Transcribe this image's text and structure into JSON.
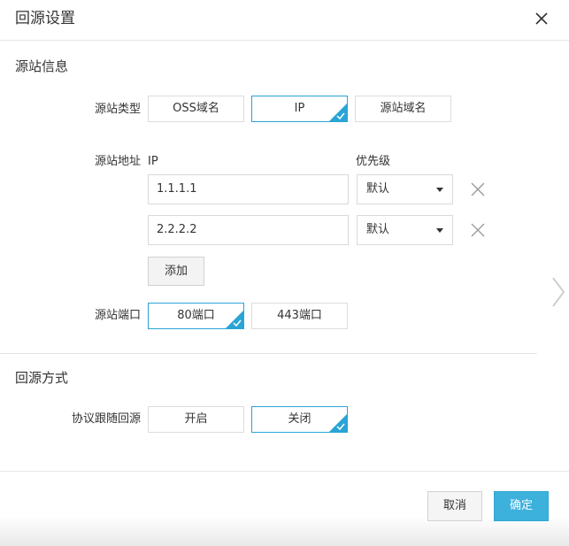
{
  "dialog": {
    "title": "回源设置",
    "close_icon": "close-icon"
  },
  "origin_info": {
    "section_title": "源站信息",
    "type": {
      "label": "源站类型",
      "options": [
        "OSS域名",
        "IP",
        "源站域名"
      ],
      "selected": "IP"
    },
    "address": {
      "label": "源站地址",
      "col_ip": "IP",
      "col_priority": "优先级",
      "rows": [
        {
          "ip": "1.1.1.1",
          "priority": "默认"
        },
        {
          "ip": "2.2.2.2",
          "priority": "默认"
        }
      ],
      "add_label": "添加"
    },
    "port": {
      "label": "源站端口",
      "options": [
        "80端口",
        "443端口"
      ],
      "selected": "80端口"
    }
  },
  "back_to_origin": {
    "section_title": "回源方式",
    "protocol_follow": {
      "label": "协议跟随回源",
      "options": [
        "开启",
        "关闭"
      ],
      "selected": "关闭"
    }
  },
  "footer": {
    "cancel_label": "取消",
    "confirm_label": "确定"
  },
  "colors": {
    "accent": "#2aa4d5",
    "primary_button": "#3cb1dc"
  },
  "icons": [
    "close-icon",
    "check-corner-icon",
    "chevron-down-icon",
    "remove-x-icon",
    "chevron-right-icon"
  ]
}
